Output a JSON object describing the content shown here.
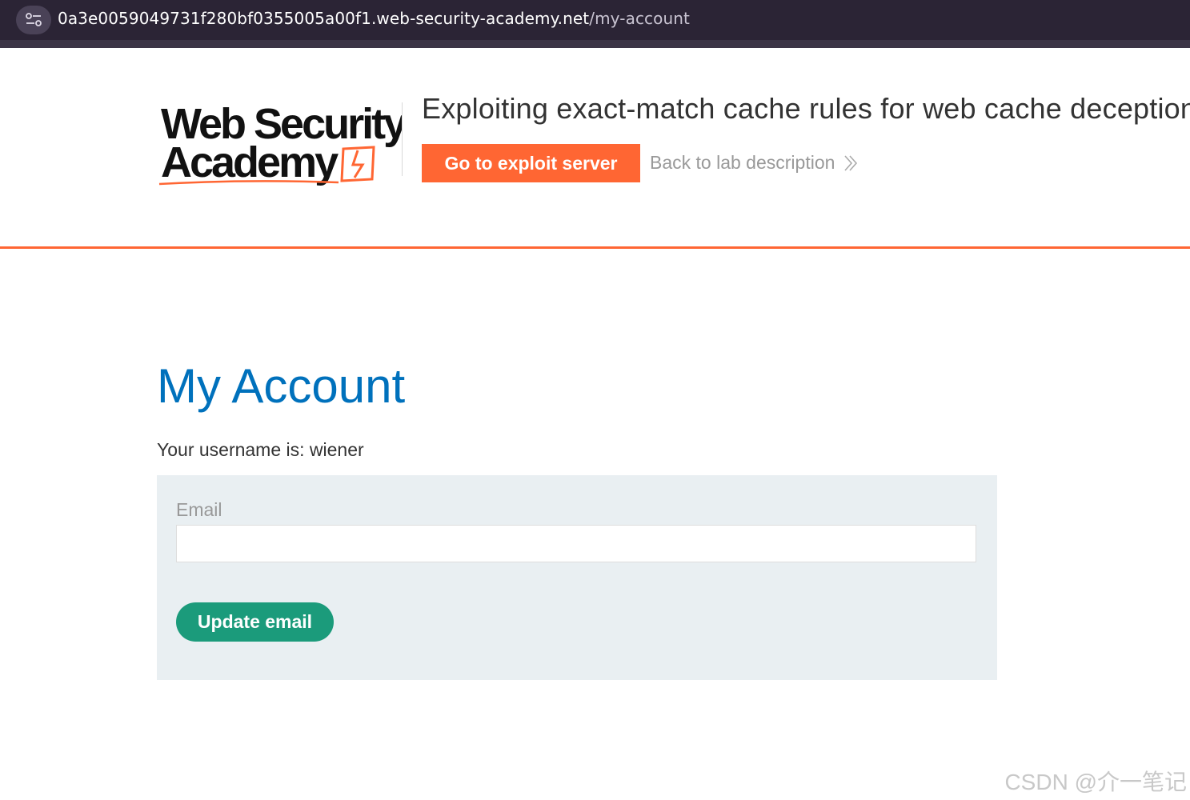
{
  "browser": {
    "url_host": "0a3e0059049731f280bf0355005a00f1.web-security-academy.net",
    "url_path": "/my-account"
  },
  "header": {
    "logo_line1": "Web Security",
    "logo_line2": "Academy",
    "lab_title": "Exploiting exact-match cache rules for web cache deception",
    "exploit_button": "Go to exploit server",
    "back_link": "Back to lab description",
    "accent_color": "#ff6633"
  },
  "main": {
    "title": "My Account",
    "username_text": "Your username is: wiener",
    "form": {
      "email_label": "Email",
      "email_value": "",
      "update_button": "Update email"
    }
  },
  "watermark": "CSDN @介一笔记"
}
